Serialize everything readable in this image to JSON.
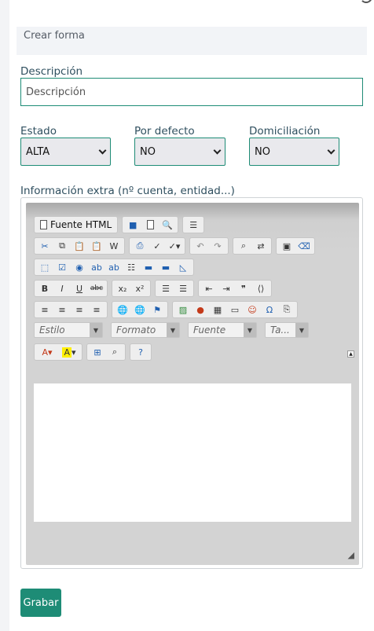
{
  "header": {
    "title": "Crear forma"
  },
  "descripcion": {
    "label": "Descripción",
    "placeholder": "Descripción"
  },
  "estado": {
    "label": "Estado",
    "value": "ALTA"
  },
  "por_defecto": {
    "label": "Por defecto",
    "value": "NO"
  },
  "domiciliacion": {
    "label": "Domiciliación",
    "value": "NO"
  },
  "info_extra": {
    "label": "Información extra (nº cuenta, entidad...)"
  },
  "editor": {
    "source_label": "Fuente HTML",
    "combo_style": "Estilo",
    "combo_format": "Formato",
    "combo_font": "Fuente",
    "combo_size": "Ta..."
  },
  "submit": {
    "label": "Grabar"
  },
  "colors": {
    "accent": "#1e8c76"
  }
}
